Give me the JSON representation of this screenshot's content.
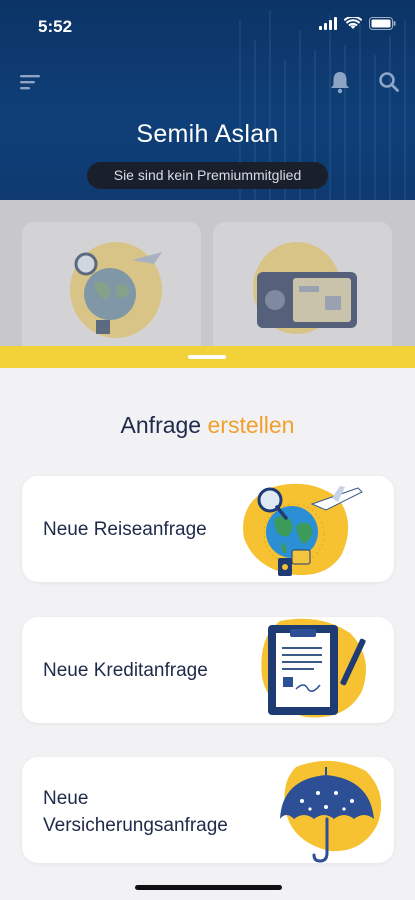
{
  "status_bar": {
    "time": "5:52"
  },
  "header": {
    "menu_icon": "menu-icon",
    "bell_icon": "bell-icon",
    "search_icon": "search-icon",
    "user_name": "Semih Aslan",
    "membership_status": "Sie sind kein Premiummitglied"
  },
  "sheet": {
    "title_part1": "Anfrage",
    "title_part2": "erstellen",
    "accent_color": "#f0a02c",
    "items": [
      {
        "label": "Neue Reiseanfrage",
        "icon": "travel-globe-icon"
      },
      {
        "label": "Neue Kreditanfrage",
        "icon": "credit-document-icon"
      },
      {
        "label_line1": "Neue",
        "label_line2": "Versicherungsanfrage",
        "icon": "insurance-umbrella-icon"
      }
    ]
  }
}
